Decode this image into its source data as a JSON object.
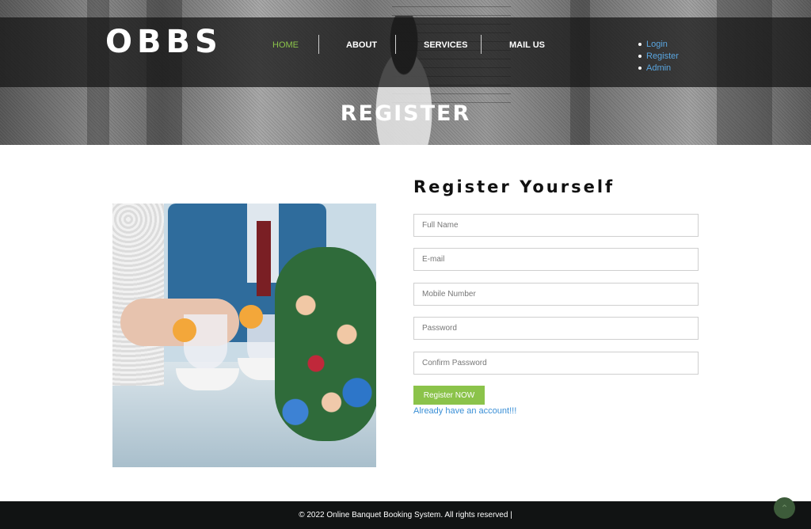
{
  "brand": {
    "logo_text": "OBBS"
  },
  "nav": {
    "items": [
      {
        "label": "HOME",
        "active": true
      },
      {
        "label": "ABOUT",
        "active": false
      },
      {
        "label": "SERVICES",
        "active": false
      },
      {
        "label": "MAIL US",
        "active": false
      }
    ],
    "auth_links": [
      "Login",
      "Register",
      "Admin"
    ]
  },
  "hero": {
    "title": "REGISTER"
  },
  "form": {
    "title": "Register Yourself",
    "fields": [
      {
        "placeholder": "Full Name",
        "value": ""
      },
      {
        "placeholder": "E-mail",
        "value": ""
      },
      {
        "placeholder": "Mobile Number",
        "value": ""
      },
      {
        "placeholder": "Password",
        "value": ""
      },
      {
        "placeholder": "Confirm Password",
        "value": ""
      }
    ],
    "submit_label": "Register NOW",
    "login_link": "Already have an account!!!"
  },
  "footer": {
    "copyright": "© 2022 Online Banquet Booking System. All rights reserved |"
  },
  "icons": {
    "scroll_top": "chevron-up-icon"
  },
  "colors": {
    "accent": "#8bc34a",
    "link": "#3a8fd6",
    "footer_bg": "#111313"
  }
}
